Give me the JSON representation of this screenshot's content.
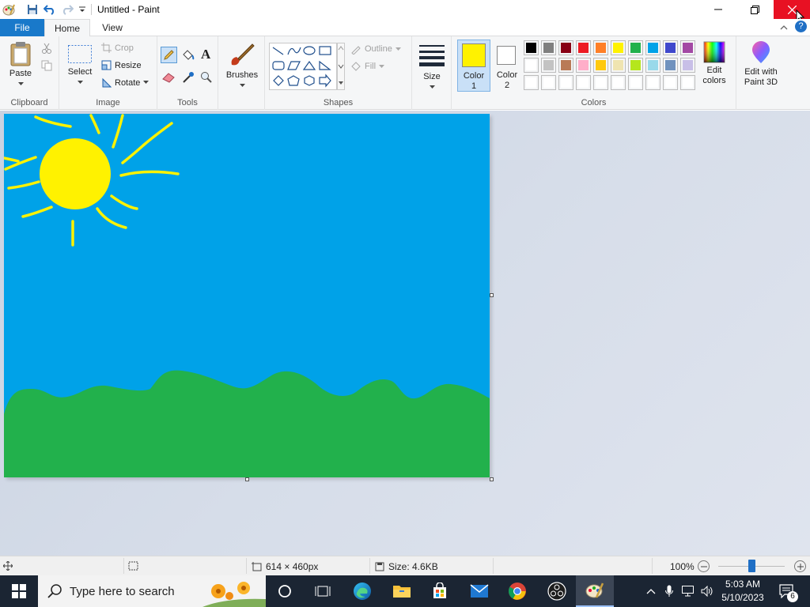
{
  "window": {
    "title": "Untitled - Paint",
    "close_icon": "close-icon",
    "minimize_icon": "minimize-icon",
    "restore_icon": "restore-icon"
  },
  "tabs": {
    "file": "File",
    "home": "Home",
    "view": "View"
  },
  "ribbon": {
    "clipboard": {
      "group_label": "Clipboard",
      "paste": "Paste"
    },
    "image": {
      "group_label": "Image",
      "select": "Select",
      "crop": "Crop",
      "resize": "Resize",
      "rotate": "Rotate"
    },
    "tools": {
      "group_label": "Tools"
    },
    "brushes": {
      "label": "Brushes"
    },
    "shapes": {
      "group_label": "Shapes",
      "outline": "Outline",
      "fill": "Fill"
    },
    "size": {
      "label": "Size"
    },
    "colors": {
      "group_label": "Colors",
      "color1": "Color",
      "color1_num": "1",
      "color2": "Color",
      "color2_num": "2",
      "color1_value": "#fff200",
      "color2_value": "#ffffff",
      "edit_colors": "Edit",
      "edit_colors_2": "colors",
      "palette_row1": [
        "#000000",
        "#7f7f7f",
        "#880015",
        "#ed1c24",
        "#ff7f27",
        "#fff200",
        "#22b14c",
        "#00a2e8",
        "#3f48cc",
        "#a349a4"
      ],
      "palette_row2": [
        "#ffffff",
        "#c3c3c3",
        "#b97a57",
        "#ffaec9",
        "#ffc90e",
        "#efe4b0",
        "#b5e61d",
        "#99d9ea",
        "#7092be",
        "#c8bfe7"
      ],
      "palette_row3": [
        "#ffffff",
        "#ffffff",
        "#ffffff",
        "#ffffff",
        "#ffffff",
        "#ffffff",
        "#ffffff",
        "#ffffff",
        "#ffffff",
        "#ffffff"
      ]
    },
    "paint3d": {
      "label": "Edit with",
      "label2": "Paint 3D"
    }
  },
  "canvas": {
    "sky_color": "#00a2e8",
    "ground_color": "#22b14c",
    "sun_color": "#fff200"
  },
  "status": {
    "dimensions": "614 × 460px",
    "size": "Size: 4.6KB",
    "zoom": "100%",
    "zoom_level": 1.0
  },
  "taskbar": {
    "search_placeholder": "Type here to search",
    "time": "5:03 AM",
    "date": "5/10/2023",
    "notifications": "6"
  }
}
